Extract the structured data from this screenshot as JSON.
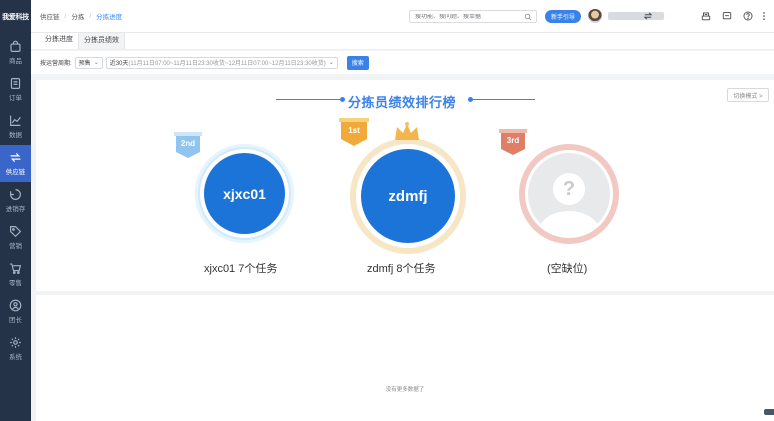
{
  "sidebar": {
    "logo": "我爱科技",
    "items": [
      {
        "label": "商品",
        "icon": "bag-icon"
      },
      {
        "label": "订单",
        "icon": "order-icon"
      },
      {
        "label": "数据",
        "icon": "chart-icon"
      },
      {
        "label": "供应链",
        "icon": "supply-chain-icon",
        "active": true
      },
      {
        "label": "进销存",
        "icon": "inventory-icon"
      },
      {
        "label": "营销",
        "icon": "tag-icon"
      },
      {
        "label": "零售",
        "icon": "cart-icon"
      },
      {
        "label": "团长",
        "icon": "person-icon"
      },
      {
        "label": "系统",
        "icon": "gear-icon"
      }
    ]
  },
  "header": {
    "breadcrumb": [
      "供应链",
      "分拣",
      "分拣进度"
    ],
    "search_placeholder": "搜功能、搜问题、搜单据",
    "guide_button": "新手引导"
  },
  "tabs": [
    "分拣进度",
    "分拣员绩效"
  ],
  "filter": {
    "label": "按运营周期:",
    "select1": "预售",
    "select2_prefix": "近30天",
    "select2_detail": "(11月11日07:00~11月11日23:30收货~12月11日07:00~12月11日23:30收货)",
    "search_button": "搜索"
  },
  "ranking": {
    "title": "分拣员绩效排行榜",
    "display_mode": "切换模式 >",
    "entries": [
      {
        "rank_badge": "2nd",
        "name": "xjxc01",
        "caption": "xjxc01 7个任务"
      },
      {
        "rank_badge": "1st",
        "name": "zdmfj",
        "caption": "zdmfj 8个任务"
      },
      {
        "rank_badge": "3rd",
        "name": "?",
        "caption": "(空缺位)"
      }
    ]
  },
  "footer": {
    "no_more": "没有更多数据了"
  },
  "colors": {
    "accent": "#3b82e8",
    "sidebar_bg": "#243348",
    "silver_ring": "#b9e1f7",
    "gold_ring": "#f6e4bf",
    "bronze_ring": "#f2c9c4"
  }
}
